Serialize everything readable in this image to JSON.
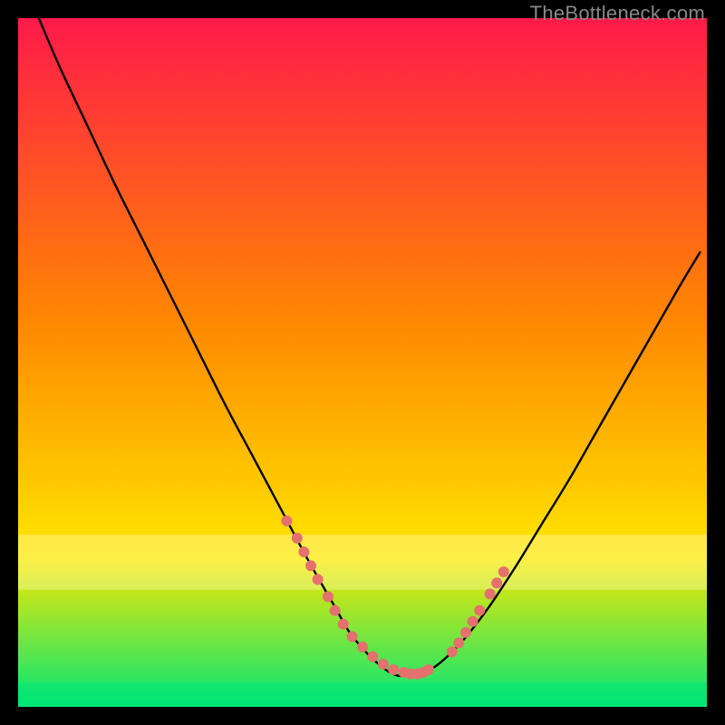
{
  "watermark": "TheBottleneck.com",
  "chart_data": {
    "type": "line",
    "title": "",
    "xlabel": "",
    "ylabel": "",
    "xlim": [
      0,
      100
    ],
    "ylim": [
      0,
      100
    ],
    "grid": false,
    "legend": false,
    "background_gradient": {
      "top": "#ff1a4a",
      "mid1": "#ff8a00",
      "mid2": "#ffe600",
      "bottom": "#00e676"
    },
    "series": [
      {
        "name": "bottleneck-curve",
        "color": "#000000",
        "x": [
          3,
          6,
          10,
          14,
          18,
          22,
          26,
          30,
          34,
          38,
          42,
          46,
          48,
          50,
          52,
          54,
          56,
          60,
          64,
          68,
          72,
          76,
          80,
          84,
          88,
          92,
          96,
          99
        ],
        "y": [
          100,
          93,
          84.5,
          76,
          68,
          60,
          52,
          44,
          36.5,
          29,
          21.5,
          14.5,
          11,
          8.5,
          6.5,
          5,
          4.5,
          5.5,
          9,
          14,
          20,
          26.5,
          33,
          40,
          47,
          54,
          61,
          66
        ]
      }
    ],
    "markers": {
      "name": "highlight-points",
      "color": "#e4716e",
      "radius": 6,
      "cluster_a": {
        "x": [
          39,
          40.5,
          41.5,
          42.5,
          43.5,
          45,
          46,
          47.2,
          48.5,
          50,
          51.5,
          53,
          54.5,
          56,
          57,
          58,
          58.8,
          59.6
        ],
        "y": [
          27,
          24.5,
          22.5,
          20.5,
          18.5,
          16,
          14,
          12,
          10.2,
          8.7,
          7.3,
          6.2,
          5.4,
          5,
          4.8,
          4.8,
          5,
          5.4
        ]
      },
      "cluster_b": {
        "x": [
          63,
          64,
          65,
          66,
          67,
          68.5,
          69.5,
          70.5
        ],
        "y": [
          8,
          9.3,
          10.8,
          12.4,
          14,
          16.4,
          18,
          19.6
        ]
      }
    },
    "bottom_band": {
      "name": "green-band",
      "color": "#00e676",
      "opacity": 0.55,
      "y_from": 0,
      "y_to": 3.5
    },
    "mid_band": {
      "name": "pale-yellow-band",
      "color": "#ffffcc",
      "opacity": 0.35,
      "y_from": 17,
      "y_to": 25
    }
  }
}
